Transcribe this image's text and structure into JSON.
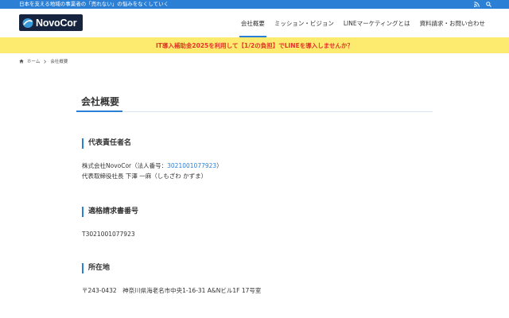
{
  "topbar": {
    "tagline": "日本を支える地域の事業者の「売れない」の悩みをなくしていく",
    "icons": [
      "rss-icon",
      "search-icon"
    ]
  },
  "header": {
    "logo_text": "NovoCor",
    "nav": [
      {
        "label": "会社概要",
        "active": true
      },
      {
        "label": "ミッション・ビジョン",
        "active": false
      },
      {
        "label": "LINEマーケティングとは",
        "active": false
      },
      {
        "label": "資料請求・お問い合わせ",
        "active": false
      }
    ]
  },
  "banner": {
    "text": "IT導入補助金2025を利用して【1/2の負担】でLINEを導入しませんか？"
  },
  "breadcrumb": {
    "home": "ホーム",
    "current": "会社概要"
  },
  "page": {
    "title": "会社概要",
    "sections": [
      {
        "heading": "代表責任者名",
        "line1_prefix": "株式会社NovoCor（法人番号：",
        "line1_link": "3021001077923",
        "line1_suffix": "）",
        "line2": "代表取締役社長 下澤 一麻（しもざわ かずま）"
      },
      {
        "heading": "適格請求書番号",
        "line1": "T3021001077923"
      },
      {
        "heading": "所在地",
        "line1": "〒243-0432　神奈川県海老名市中央1-16-31 A&Nビル1F 17号室"
      }
    ]
  },
  "colors": {
    "topbar": "#2b7fd4",
    "banner_bg": "#fdeb70",
    "banner_text": "#e4332a",
    "accent": "#2b7fd4",
    "logo_bg": "#16243f"
  }
}
